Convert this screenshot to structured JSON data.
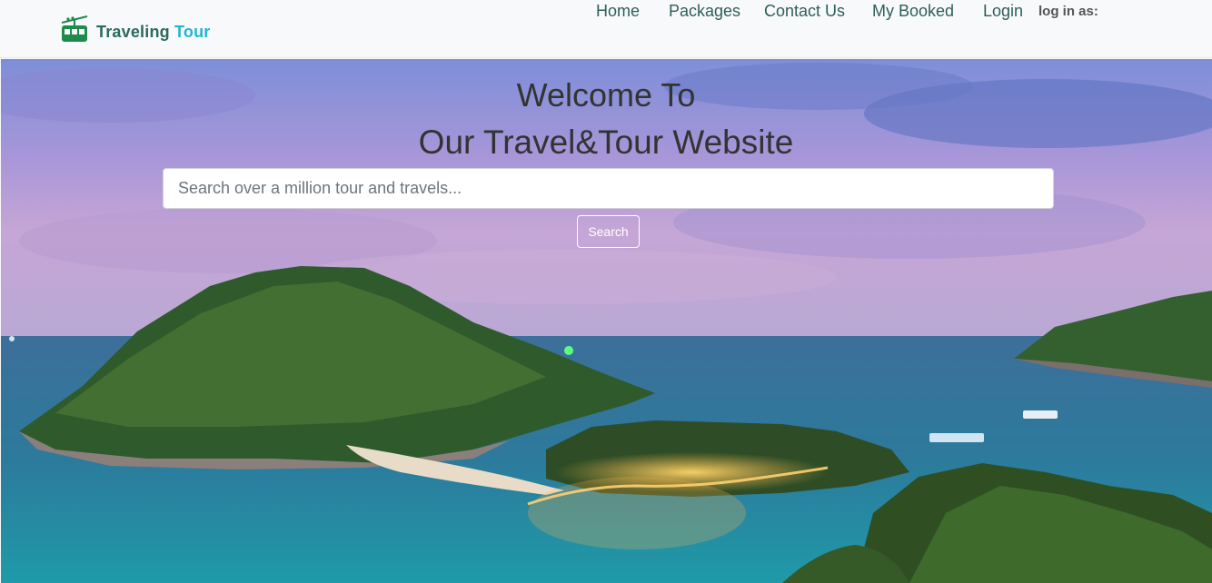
{
  "brand": {
    "name_primary": "Traveling",
    "name_accent": "Tour",
    "icon": "cable-car-icon",
    "colors": {
      "primary": "#2a6b5e",
      "accent": "#22b4d0",
      "icon": "#1e8a4c"
    }
  },
  "nav": {
    "items": [
      {
        "label": "Home"
      },
      {
        "label": "Packages"
      },
      {
        "label": "Contact Us"
      },
      {
        "label": "My Booked"
      },
      {
        "label": "Login"
      }
    ],
    "login_status": "log in as:",
    "link_color": "#2d5f5a"
  },
  "hero": {
    "title_line1": "Welcome To",
    "title_line2": "Our Travel&Tour Website",
    "background": "tropical-island-bay-at-dusk"
  },
  "search": {
    "placeholder": "Search over a million tour and travels...",
    "value": "",
    "button_label": "Search"
  }
}
